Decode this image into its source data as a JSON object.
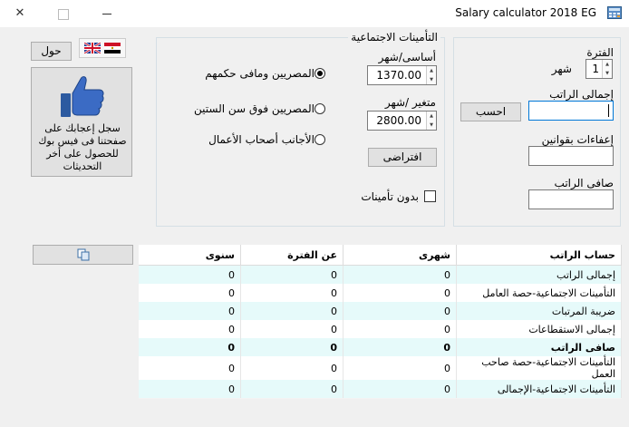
{
  "window": {
    "title": "Salary calculator 2018 EG",
    "icon": "calculator-icon",
    "controls": [
      "close-icon",
      "maximize-icon",
      "minimize-icon"
    ]
  },
  "toolbar": {
    "about_label": "حول",
    "language_icons": [
      "uk-flag-icon",
      "egypt-flag-icon"
    ]
  },
  "facebook": {
    "icon": "thumbs-up-icon",
    "text": "سجل إعجابك على صفحتنا فى فيس بوك للحصول على أخر التحديثات"
  },
  "insurance": {
    "title": "التأمينات الاجتماعية",
    "basic_label": "أساسى/شهر",
    "basic_value": "1370.00",
    "variable_label": "متغير /شهر",
    "variable_value": "2800.00",
    "default_label": "افتراضى",
    "options": [
      {
        "label": "المصريين ومافى حكمهم",
        "selected": true
      },
      {
        "label": "المصريين فوق سن الستين",
        "selected": false
      },
      {
        "label": "الأجانب أصحاب الأعمال",
        "selected": false
      }
    ],
    "no_insurance_label": "بدون تأمينات",
    "no_insurance_checked": false
  },
  "period": {
    "label": "الفترة",
    "value": "1",
    "unit": "شهر"
  },
  "calc": {
    "gross_label": "إجمالى الراتب",
    "gross_value": "",
    "calculate_label": "احسب",
    "exemptions_label": "إعفاءات بقوانين",
    "exemptions_value": "",
    "net_label": "صافى الراتب",
    "net_value": ""
  },
  "copy_icon": "copy-icon",
  "results": {
    "headers": [
      "حساب الراتب",
      "شهرى",
      "عن الفترة",
      "سنوى"
    ],
    "rows": [
      {
        "label": "إجمالى الراتب",
        "values": [
          "0",
          "0",
          "0"
        ]
      },
      {
        "label": "التأمينات الاجتماعية-حصة العامل",
        "values": [
          "0",
          "0",
          "0"
        ]
      },
      {
        "label": "ضريبة المرتبات",
        "values": [
          "0",
          "0",
          "0"
        ]
      },
      {
        "label": "إجمالى الاستقطاعات",
        "values": [
          "0",
          "0",
          "0"
        ]
      },
      {
        "label": "صافى الراتب",
        "values": [
          "0",
          "0",
          "0"
        ],
        "bold": true
      },
      {
        "label": "التأمينات الاجتماعية-حصة صاحب العمل",
        "values": [
          "0",
          "0",
          "0"
        ]
      },
      {
        "label": "التأمينات الاجتماعية-الإجمالى",
        "values": [
          "0",
          "0",
          "0"
        ]
      }
    ]
  },
  "colors": {
    "row_alt": "#e6fafa",
    "active_border": "#0078d7"
  }
}
